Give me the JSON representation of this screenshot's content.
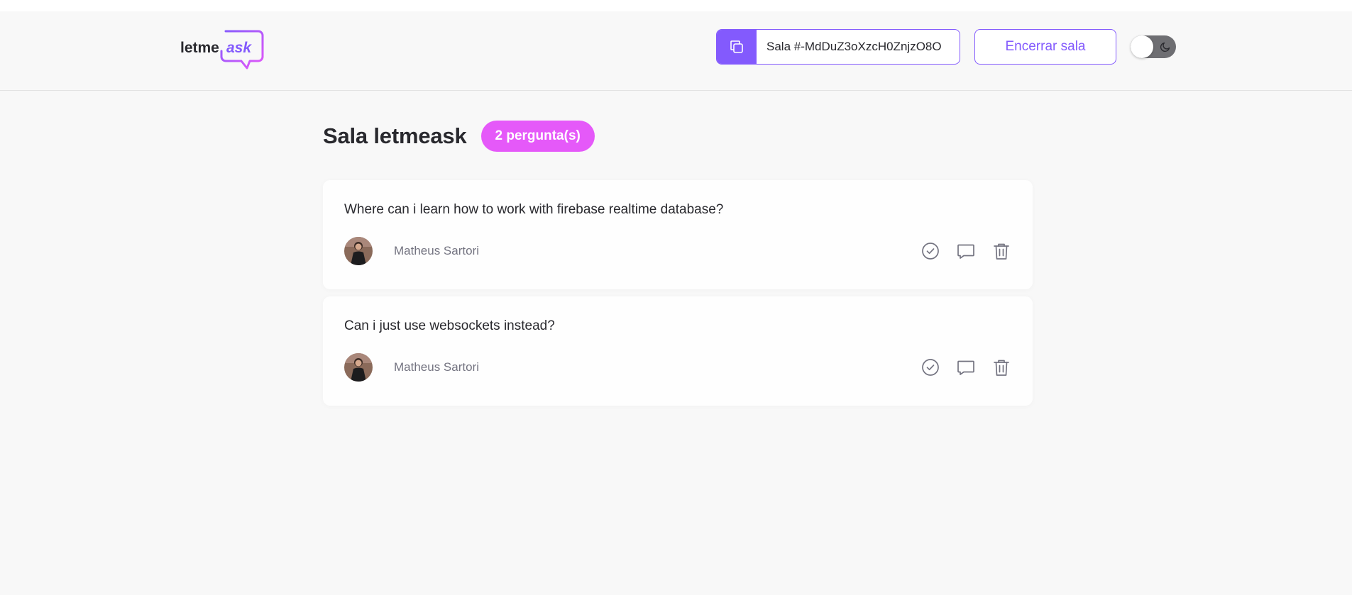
{
  "header": {
    "logo": {
      "text_dark": "letme",
      "text_accent": "ask"
    },
    "room_code": {
      "label": "Sala #-MdDuZ3oXzcH0ZnjzO8O",
      "icon": "copy-icon"
    },
    "close_room_label": "Encerrar sala",
    "theme_toggle": {
      "icon": "moon-icon",
      "dark_mode": false
    }
  },
  "room": {
    "title": "Sala letmeask",
    "question_count_label": "2 pergunta(s)"
  },
  "questions": [
    {
      "content": "Where can i learn how to work with firebase realtime database?",
      "author": "Matheus Sartori",
      "actions": [
        "check-circle-icon",
        "answer-icon",
        "trash-icon"
      ]
    },
    {
      "content": "Can i just use websockets instead?",
      "author": "Matheus Sartori",
      "actions": [
        "check-circle-icon",
        "answer-icon",
        "trash-icon"
      ]
    }
  ],
  "colors": {
    "accent": "#835afd",
    "badge": "#e559f9",
    "background": "#f8f8f8",
    "text": "#29292e",
    "muted": "#737380"
  }
}
